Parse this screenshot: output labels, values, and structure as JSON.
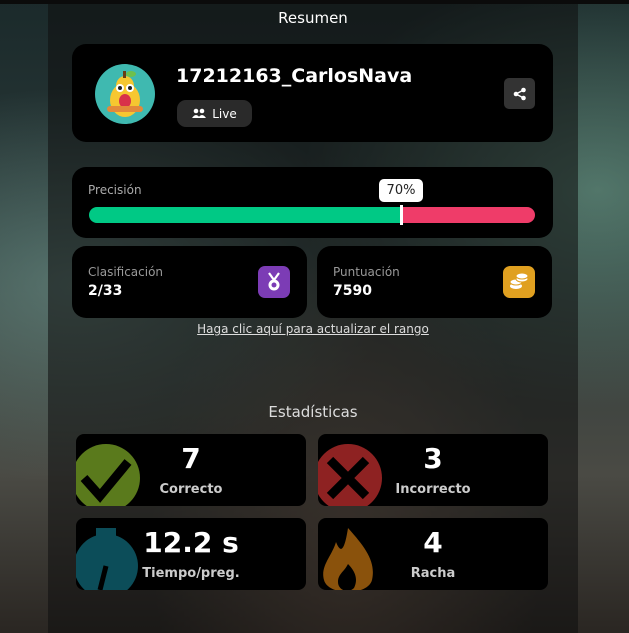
{
  "header": {
    "title": "Resumen"
  },
  "profile": {
    "username": "17212163_CarlosNava",
    "mode_label": "Live",
    "avatar_icon": "pear-avatar-icon",
    "share_icon": "share-icon"
  },
  "accuracy": {
    "label": "Precisión",
    "percent_text": "70%",
    "percent": 70,
    "correct_color": "#00c985",
    "incorrect_color": "#ef3c69"
  },
  "rank": {
    "label": "Clasificación",
    "value": "2/33",
    "icon": "medal-icon",
    "icon_color": "#7c3cb5"
  },
  "score": {
    "label": "Puntuación",
    "value": "7590",
    "icon": "coins-icon",
    "icon_color": "#e0a020"
  },
  "refresh_link": "Haga clic aquí para actualizar el rango",
  "stats": {
    "heading": "Estadísticas",
    "items": [
      {
        "value": "7",
        "label": "Correcto",
        "icon": "check-icon",
        "color": "#6a8f1e"
      },
      {
        "value": "3",
        "label": "Incorrecto",
        "icon": "cross-icon",
        "color": "#a82a2a"
      },
      {
        "value": "12.2 s",
        "label": "Tiempo/preg.",
        "icon": "stopwatch-icon",
        "color": "#0e5d6b"
      },
      {
        "value": "4",
        "label": "Racha",
        "icon": "flame-icon",
        "color": "#b06a10"
      }
    ]
  }
}
